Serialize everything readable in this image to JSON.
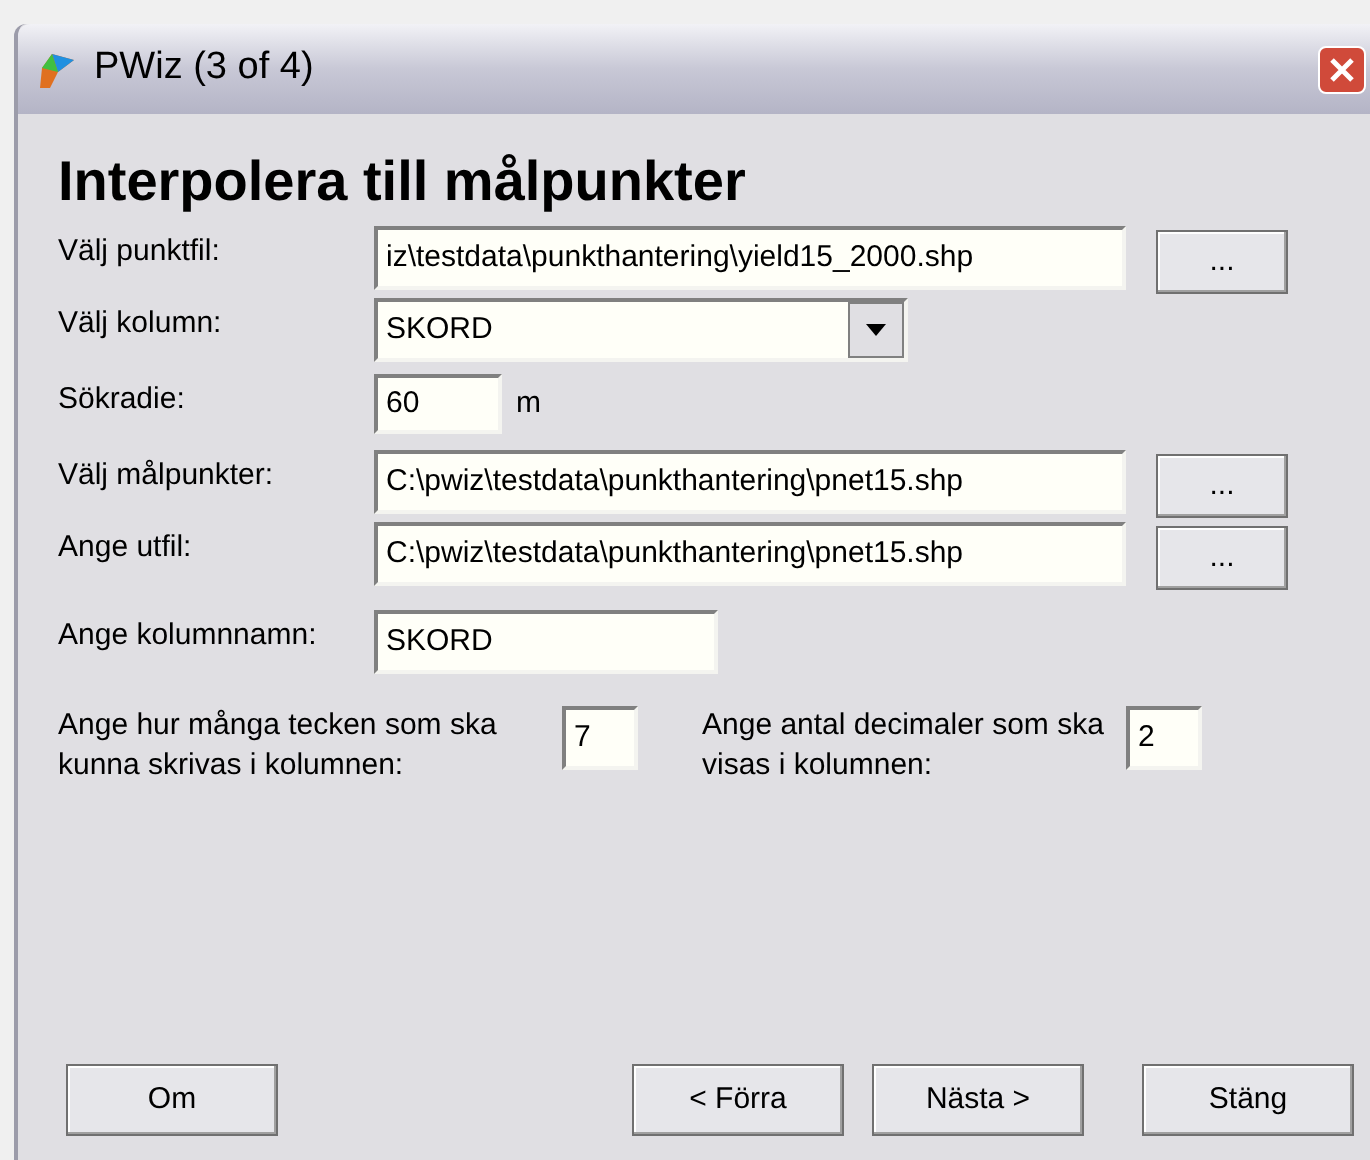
{
  "window": {
    "title": "PWiz (3 of 4)"
  },
  "heading": "Interpolera till målpunkter",
  "rows": [
    {
      "kind": "file",
      "label": "Välj punktfil:",
      "value": "iz\\testdata\\punkthantering\\yield15_2000.shp",
      "browse": "..."
    },
    {
      "kind": "combo",
      "label": "Välj kolumn:",
      "value": "SKORD"
    },
    {
      "kind": "number",
      "label": "Sökradie:",
      "value": "60",
      "unit": "m"
    },
    {
      "kind": "file",
      "label": "Välj målpunkter:",
      "value": "C:\\pwiz\\testdata\\punkthantering\\pnet15.shp",
      "browse": "..."
    },
    {
      "kind": "file",
      "label": "Ange utfil:",
      "value": "C:\\pwiz\\testdata\\punkthantering\\pnet15.shp",
      "browse": "..."
    },
    {
      "kind": "text",
      "label": "Ange kolumnnamn:",
      "value": "SKORD"
    }
  ],
  "width_field": {
    "label": "Ange hur många tecken som ska kunna skrivas i kolumnen:",
    "value": "7"
  },
  "decimals_field": {
    "label": "Ange antal decimaler som ska visas i kolumnen:",
    "value": "2"
  },
  "buttons": {
    "about": "Om",
    "back": "< Förra",
    "next": "Nästa >",
    "close": "Stäng"
  }
}
